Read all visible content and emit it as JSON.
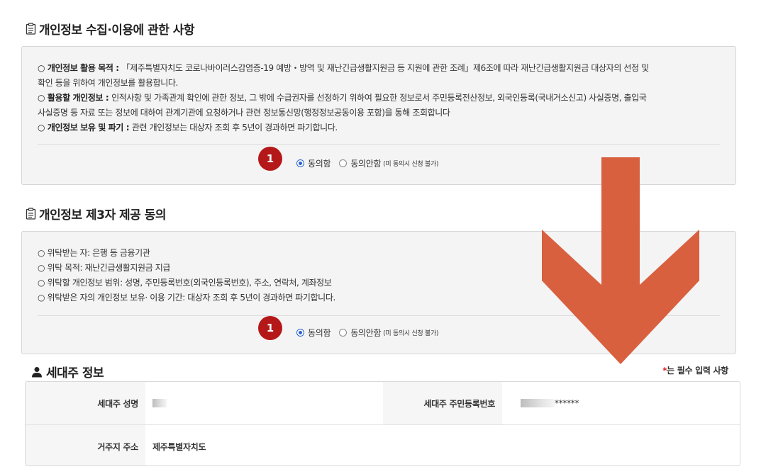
{
  "section1": {
    "title": "개인정보 수집·이용에 관한 사항",
    "lines": [
      {
        "label": "○ 개인정보 활용 목적 : ",
        "text": "「제주특별자치도 코로나바이러스감염증-19 예방・방역 및 재난긴급생활지원금 등 지원에 관한 조례」제6조에 따라 재난긴급생활지원금 대상자의 선정 및"
      },
      {
        "label": "",
        "text": "확인 등을 위하여 개인정보를 활용합니다."
      },
      {
        "label": "○ 활용할 개인정보 : ",
        "text": "인적사항 및 가족관계 확인에 관한 정보, 그 밖에 수급권자를 선정하기 위하여 필요한 정보로서 주민등록전산정보, 외국인등록(국내거소신고) 사실증명, 출입국"
      },
      {
        "label": "",
        "text": "사실증명 등 자료 또는 정보에 대하여 관계기관에 요청하거나 관련 정보통신망(행정정보공동이용 포함)을 통해 조회합니다"
      },
      {
        "label": "○ 개인정보 보유 및 파기 : ",
        "text": "관련 개인정보는 대상자 조회 후 5년이 경과하면 파기합니다."
      }
    ],
    "agree_label": "동의함",
    "disagree_label": "동의안함",
    "disagree_note": "(미 동의시 신청 불가)",
    "badge": "1"
  },
  "section2": {
    "title": "개인정보 제3자 제공 동의",
    "lines": [
      "○ 위탁받는 자: 은행 등 금융기관",
      "○ 위탁 목적: 재난긴급생활지원금 지급",
      "○ 위탁할 개인정보 범위: 성명, 주민등록번호(외국인등록번호), 주소, 연락처, 계좌정보",
      "○ 위탁받은 자의 개인정보 보유· 이용 기간: 대상자 조회 후 5년이 경과하면 파기합니다."
    ],
    "agree_label": "동의함",
    "disagree_label": "동의안함",
    "disagree_note": "(미 동의시 신청 불가)",
    "badge": "1"
  },
  "householder": {
    "title": "세대주 정보",
    "required_star": "*",
    "required_note": "는 필수 입력 사항",
    "name_label": "세대주 성명",
    "rrn_label": "세대주 주민등록번호",
    "rrn_masked": "******",
    "address_label": "거주지 주소",
    "address_value": "제주특별자치도"
  },
  "colors": {
    "badge": "#b51818",
    "arrow": "#d9603f",
    "radio_selected": "#2a63d0",
    "required_star": "#e02020"
  },
  "icons": {
    "section_icon": "clipboard-icon",
    "person_icon": "person-icon",
    "arrow": "down-arrow-icon"
  }
}
